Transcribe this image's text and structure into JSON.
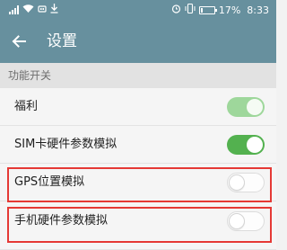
{
  "status_bar": {
    "left_icons": [
      "signal-icon",
      "wifi-icon",
      "usb-icon",
      "download-icon"
    ],
    "right_icons": [
      "alarm-icon",
      "vibrate-icon",
      "battery-icon"
    ],
    "battery_percent": "17%",
    "battery_level": 0.17,
    "time": "8:33"
  },
  "app_bar": {
    "back_icon": "back-arrow-icon",
    "title": "设置"
  },
  "section": {
    "header": "功能开关"
  },
  "rows": [
    {
      "label": "福利",
      "toggle_on": true
    },
    {
      "label": "SIM卡硬件参数模拟",
      "toggle_on": true
    },
    {
      "label": "GPS位置模拟",
      "toggle_on": false,
      "highlighted": true
    },
    {
      "label": "手机硬件参数模拟",
      "toggle_on": false,
      "highlighted": true
    }
  ],
  "colors": {
    "app_bar": "#67909e",
    "toggle_on_light": "#9ed79b",
    "toggle_on": "#53b14f",
    "highlight_border": "#e53935"
  }
}
